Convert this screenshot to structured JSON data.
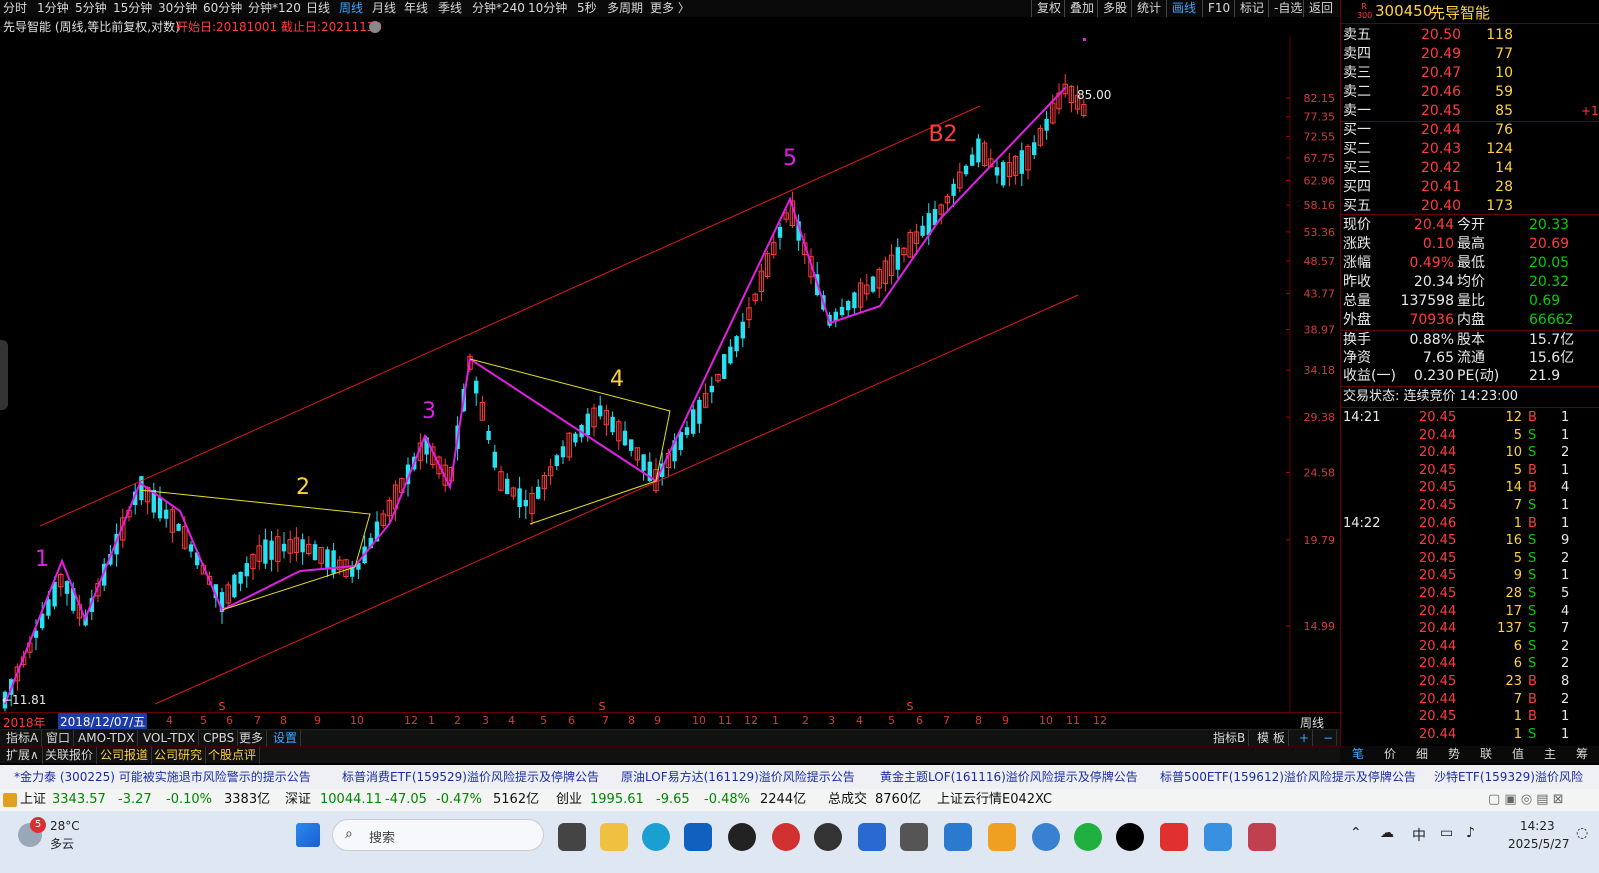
{
  "topbar": {
    "periods": [
      "分时",
      "1分钟",
      "5分钟",
      "15分钟",
      "30分钟",
      "60分钟",
      "分钟*120",
      "日线",
      "周线",
      "月线",
      "年线",
      "季线",
      "分钟*240",
      "10分钟",
      "5秒",
      "多周期",
      "更多 〉"
    ],
    "active_period": "周线",
    "tools": [
      "复权",
      "叠加",
      "多股",
      "统计",
      "画线",
      "F10",
      "标记",
      "-自选",
      "返回"
    ],
    "active_tool": "画线"
  },
  "title": {
    "stock": "先导智能 (周线,等比前复权,对数)",
    "range": "开始日:20181001 截止日:20211130"
  },
  "chart": {
    "price_axis": [
      "82.15",
      "77.35",
      "72.55",
      "67.75",
      "62.96",
      "58.16",
      "53.36",
      "48.57",
      "43.77",
      "38.97",
      "34.18",
      "29.38",
      "24.58",
      "19.79",
      "14.99"
    ],
    "high_label": "85.00",
    "low_label": "←11.81",
    "wave_labels": [
      "1",
      "2",
      "3",
      "4",
      "5",
      "B2"
    ],
    "colors": {
      "up": "#ff3c3c",
      "down": "#28e0f0",
      "wave": "#e020e0",
      "channel": "#dd1a1a",
      "triangle": "#e8e020",
      "label_yellow": "#ffd23c"
    }
  },
  "time_axis": {
    "year_label": "2018年",
    "cursor_date": "2018/12/07/五",
    "ticks": [
      "4",
      "5",
      "6",
      "7",
      "8",
      "9",
      "10",
      "12",
      "1",
      "2",
      "3",
      "4",
      "5",
      "6",
      "7",
      "8",
      "9",
      "10",
      "11",
      "12",
      "1",
      "2",
      "3",
      "4",
      "5",
      "6",
      "7",
      "8",
      "9",
      "10",
      "11",
      "12"
    ],
    "period": "周线"
  },
  "tabs": {
    "row1": [
      "指标A",
      "窗口",
      "AMO-TDX",
      "VOL-TDX",
      "CPBS",
      "更多",
      "设置"
    ],
    "row1_right": [
      "指标B",
      "模 板",
      "+",
      "−"
    ],
    "row2": [
      "扩展∧",
      "关联报价",
      "公司报道",
      "公司研究",
      "个股点评"
    ]
  },
  "quote": {
    "code": "300450",
    "name": "先导智能",
    "badge": "R 300",
    "asks": [
      {
        "label": "卖五",
        "price": "20.50",
        "vol": "118"
      },
      {
        "label": "卖四",
        "price": "20.49",
        "vol": "77"
      },
      {
        "label": "卖三",
        "price": "20.47",
        "vol": "10"
      },
      {
        "label": "卖二",
        "price": "20.46",
        "vol": "59"
      },
      {
        "label": "卖一",
        "price": "20.45",
        "vol": "85",
        "extra": "+1"
      }
    ],
    "bids": [
      {
        "label": "买一",
        "price": "20.44",
        "vol": "76"
      },
      {
        "label": "买二",
        "price": "20.43",
        "vol": "124"
      },
      {
        "label": "买三",
        "price": "20.42",
        "vol": "14"
      },
      {
        "label": "买四",
        "price": "20.41",
        "vol": "28"
      },
      {
        "label": "买五",
        "price": "20.40",
        "vol": "173"
      }
    ],
    "stats": [
      {
        "l1": "现价",
        "v1": "20.44",
        "l2": "今开",
        "v2": "20.33",
        "c1": "red",
        "c2": "green"
      },
      {
        "l1": "涨跌",
        "v1": "0.10",
        "l2": "最高",
        "v2": "20.69",
        "c1": "red",
        "c2": "red"
      },
      {
        "l1": "涨幅",
        "v1": "0.49%",
        "l2": "最低",
        "v2": "20.05",
        "c1": "red",
        "c2": "green"
      },
      {
        "l1": "昨收",
        "v1": "20.34",
        "l2": "均价",
        "v2": "20.32",
        "c1": "white",
        "c2": "green"
      },
      {
        "l1": "总量",
        "v1": "137598",
        "l2": "量比",
        "v2": "0.69",
        "c1": "white",
        "c2": "green"
      },
      {
        "l1": "外盘",
        "v1": "70936",
        "l2": "内盘",
        "v2": "66662",
        "c1": "red",
        "c2": "green"
      }
    ],
    "stats2": [
      {
        "l1": "换手",
        "v1": "0.88%",
        "l2": "股本",
        "v2": "15.7亿"
      },
      {
        "l1": "净资",
        "v1": "7.65",
        "l2": "流通",
        "v2": "15.6亿"
      },
      {
        "l1": "收益(一)",
        "v1": "0.230",
        "l2": "PE(动)",
        "v2": "21.9"
      }
    ],
    "trade_state": "交易状态: 连续竞价 14:23:00",
    "ticks": [
      {
        "t": "14:21",
        "p": "20.45",
        "v": "12",
        "s": "B",
        "n": "1"
      },
      {
        "t": "",
        "p": "20.44",
        "v": "5",
        "s": "S",
        "n": "1"
      },
      {
        "t": "",
        "p": "20.44",
        "v": "10",
        "s": "S",
        "n": "2"
      },
      {
        "t": "",
        "p": "20.45",
        "v": "5",
        "s": "B",
        "n": "1"
      },
      {
        "t": "",
        "p": "20.45",
        "v": "14",
        "s": "B",
        "n": "4"
      },
      {
        "t": "",
        "p": "20.45",
        "v": "7",
        "s": "S",
        "n": "1"
      },
      {
        "t": "14:22",
        "p": "20.46",
        "v": "1",
        "s": "B",
        "n": "1"
      },
      {
        "t": "",
        "p": "20.45",
        "v": "16",
        "s": "S",
        "n": "9"
      },
      {
        "t": "",
        "p": "20.45",
        "v": "5",
        "s": "S",
        "n": "2"
      },
      {
        "t": "",
        "p": "20.45",
        "v": "9",
        "s": "S",
        "n": "1"
      },
      {
        "t": "",
        "p": "20.45",
        "v": "28",
        "s": "S",
        "n": "5"
      },
      {
        "t": "",
        "p": "20.44",
        "v": "17",
        "s": "S",
        "n": "4"
      },
      {
        "t": "",
        "p": "20.44",
        "v": "137",
        "s": "S",
        "n": "7"
      },
      {
        "t": "",
        "p": "20.44",
        "v": "6",
        "s": "S",
        "n": "2"
      },
      {
        "t": "",
        "p": "20.44",
        "v": "6",
        "s": "S",
        "n": "2"
      },
      {
        "t": "",
        "p": "20.45",
        "v": "23",
        "s": "B",
        "n": "8"
      },
      {
        "t": "",
        "p": "20.44",
        "v": "7",
        "s": "B",
        "n": "2"
      },
      {
        "t": "",
        "p": "20.45",
        "v": "1",
        "s": "B",
        "n": "1"
      },
      {
        "t": "",
        "p": "20.44",
        "v": "1",
        "s": "S",
        "n": "1"
      }
    ],
    "bottom_tabs": [
      "笔",
      "价",
      "细",
      "势",
      "联",
      "值",
      "主",
      "筹"
    ]
  },
  "ticker": [
    "*金力泰 (300225) 可能被实施退市风险警示的提示公告",
    "标普消费ETF(159529)溢价风险提示及停牌公告",
    "原油LOF易方达(161129)溢价风险提示公告",
    "黄金主题LOF(161116)溢价风险提示及停牌公告",
    "标普500ETF(159612)溢价风险提示及停牌公告",
    "沙特ETF(159329)溢价风险"
  ],
  "status": {
    "sh_label": "上证",
    "sh_val": "3343.57",
    "sh_chg": "-3.27",
    "sh_pct": "-0.10%",
    "sh_amt": "3383亿",
    "sz_label": "深证",
    "sz_val": "10044.11",
    "sz_chg": "-47.05",
    "sz_pct": "-0.47%",
    "sz_amt": "5162亿",
    "cy_label": "创业",
    "cy_val": "1995.61",
    "cy_chg": "-9.65",
    "cy_pct": "-0.48%",
    "cy_amt": "2244亿",
    "total_label": "总成交",
    "total_val": "8760亿",
    "server": "上证云行情E042XC"
  },
  "taskbar": {
    "weather_temp": "28°C",
    "weather_desc": "多云",
    "weather_badge": "5",
    "search": "搜索",
    "ime": "中",
    "time": "14:23",
    "date": "2025/5/27"
  }
}
